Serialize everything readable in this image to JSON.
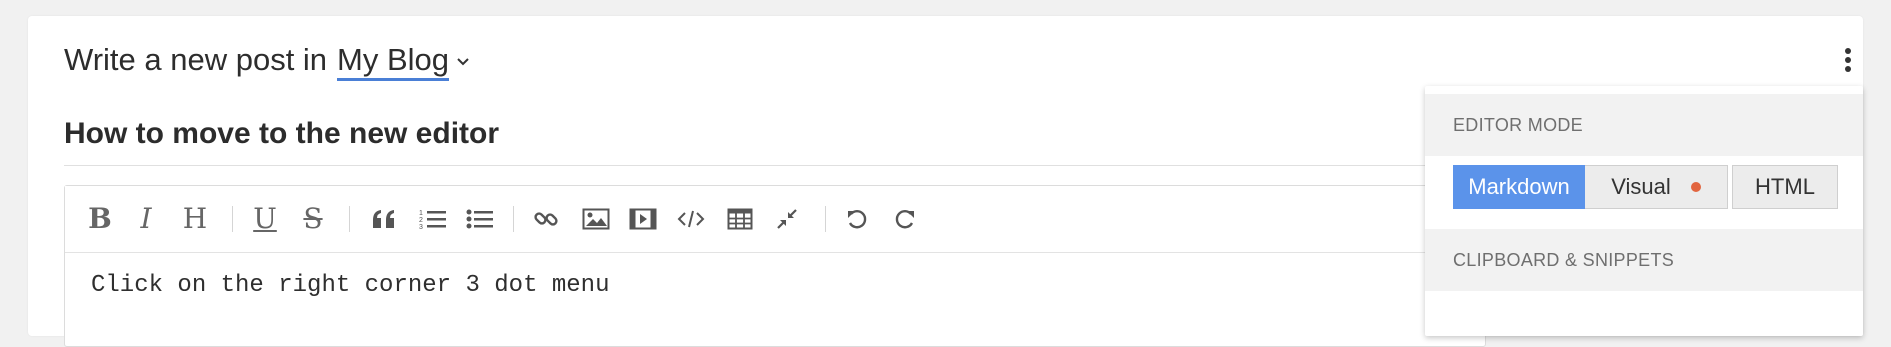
{
  "header": {
    "prefix": "Write a new post in",
    "blog_name": "My Blog"
  },
  "post": {
    "title": "How to move to the new editor",
    "body": "Click on the right corner 3 dot menu"
  },
  "toolbar": {
    "bold": "B",
    "italic": "I",
    "heading": "H",
    "underline": "U",
    "strikethrough": "S",
    "icons": [
      "quote-icon",
      "ordered-list-icon",
      "bullet-list-icon",
      "link-icon",
      "image-icon",
      "video-icon",
      "code-icon",
      "table-icon",
      "collapse-icon",
      "undo-icon",
      "redo-icon"
    ]
  },
  "menu": {
    "editor_mode_label": "EDITOR MODE",
    "modes": [
      "Markdown",
      "Visual",
      "HTML"
    ],
    "active_mode": "Markdown",
    "clipboard_label": "CLIPBOARD & SNIPPETS"
  },
  "colors": {
    "accent": "#5b93ea",
    "link_underline": "#4a7fd6",
    "dot": "#e2653f"
  }
}
